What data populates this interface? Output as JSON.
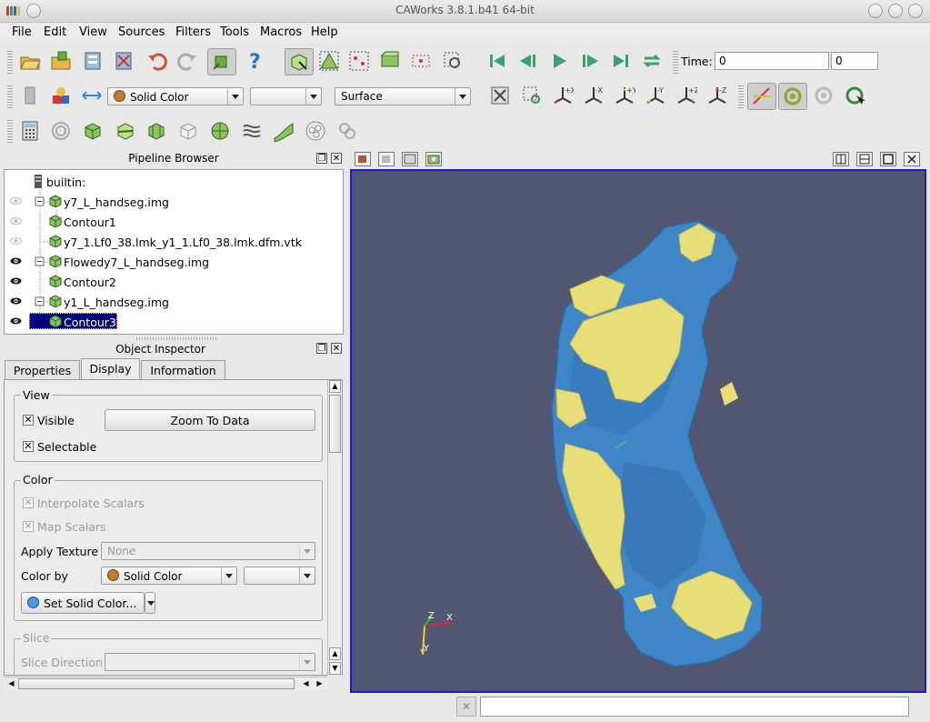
{
  "window": {
    "title": "CAWorks 3.8.1.b41 64-bit"
  },
  "menu": [
    "File",
    "Edit",
    "View",
    "Sources",
    "Filters",
    "Tools",
    "Macros",
    "Help"
  ],
  "time": {
    "label": "Time:",
    "value": "0",
    "step_value": "0"
  },
  "toolbar2": {
    "color_combo": "Solid Color",
    "component_combo": "",
    "representation_combo": "Surface"
  },
  "pipeline_browser": {
    "title": "Pipeline Browser",
    "items": [
      {
        "name": "builtin:"
      },
      {
        "name": "y7_L_handseg.img"
      },
      {
        "name": "Contour1"
      },
      {
        "name": "y7_1.Lf0_38.lmk_y1_1.Lf0_38.lmk.dfm.vtk"
      },
      {
        "name": "Flowedy7_L_handseg.img"
      },
      {
        "name": "Contour2"
      },
      {
        "name": "y1_L_handseg.img"
      },
      {
        "name": "Contour3"
      }
    ]
  },
  "object_inspector": {
    "title": "Object Inspector",
    "tabs": [
      "Properties",
      "Display",
      "Information"
    ],
    "active_tab": "Display",
    "view_group": {
      "title": "View",
      "visible": "Visible",
      "zoom_button": "Zoom To Data",
      "selectable": "Selectable"
    },
    "color_group": {
      "title": "Color",
      "interpolate": "Interpolate Scalars",
      "map_scalars": "Map Scalars",
      "apply_texture_label": "Apply Texture",
      "apply_texture_value": "None",
      "color_by_label": "Color by",
      "color_by_value": "Solid Color",
      "color_by_component": "",
      "set_solid_color": "Set Solid Color..."
    },
    "slice_group": {
      "title": "Slice",
      "direction_label": "Slice Direction",
      "direction_value": ""
    }
  },
  "axes": {
    "x": "X",
    "y": "Y",
    "z": "Z"
  },
  "colors": {
    "viewport_bg": "#525670",
    "surface_blue": "#3f86c7",
    "surface_yellow": "#e7de78",
    "active_border": "#1c1ccc",
    "selection": "#000080"
  }
}
